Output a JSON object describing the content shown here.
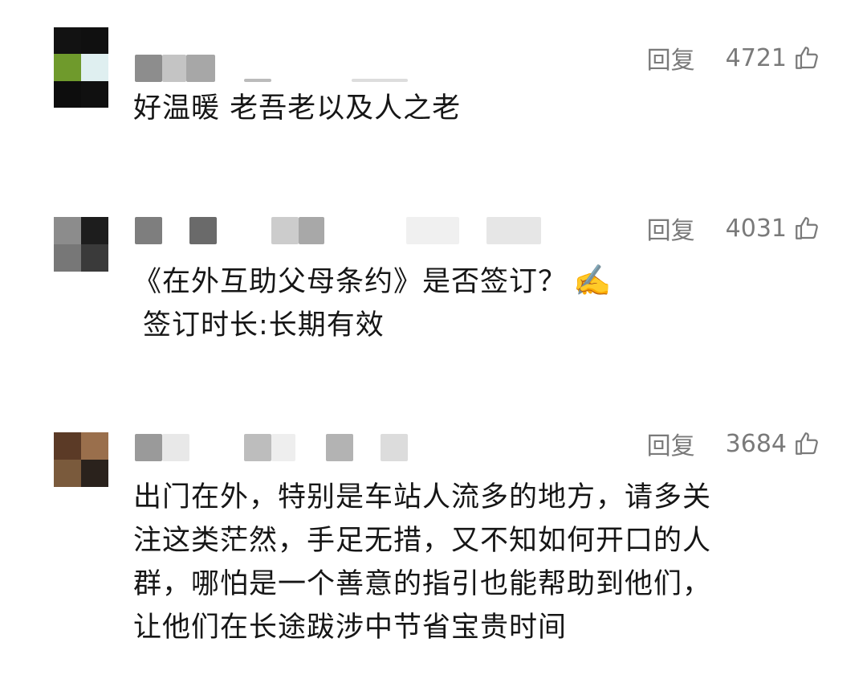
{
  "comments": [
    {
      "avatar_colors": [
        "#121212",
        "#101010",
        "#6f9a2c",
        "#dfeff0",
        "#0d0d0d",
        "#101010"
      ],
      "reply_label": "回复",
      "likes": "4721",
      "lines": [
        "好温暖 老吾老以及人之老"
      ]
    },
    {
      "avatar_colors": [
        "#8c8c8c",
        "#1d1d1d",
        "#777777",
        "#3a3a3a"
      ],
      "reply_label": "回复",
      "likes": "4031",
      "lines": [
        "《在外互助父母条约》是否签订？",
        "签订时长:长期有效"
      ],
      "emoji": "✍️"
    },
    {
      "avatar_colors": [
        "#5b3a26",
        "#9a6f4c",
        "#7a5a3c",
        "#2a221c"
      ],
      "reply_label": "回复",
      "likes": "3684",
      "lines": [
        "出门在外，特别是车站人流多的地方，请多关",
        "注这类茫然，手足无措，又不知如何开口的人",
        "群，哪怕是一个善意的指引也能帮助到他们，",
        "让他们在长途跋涉中节省宝贵时间"
      ]
    }
  ],
  "icons": {
    "like": "thumbs-up-icon"
  }
}
